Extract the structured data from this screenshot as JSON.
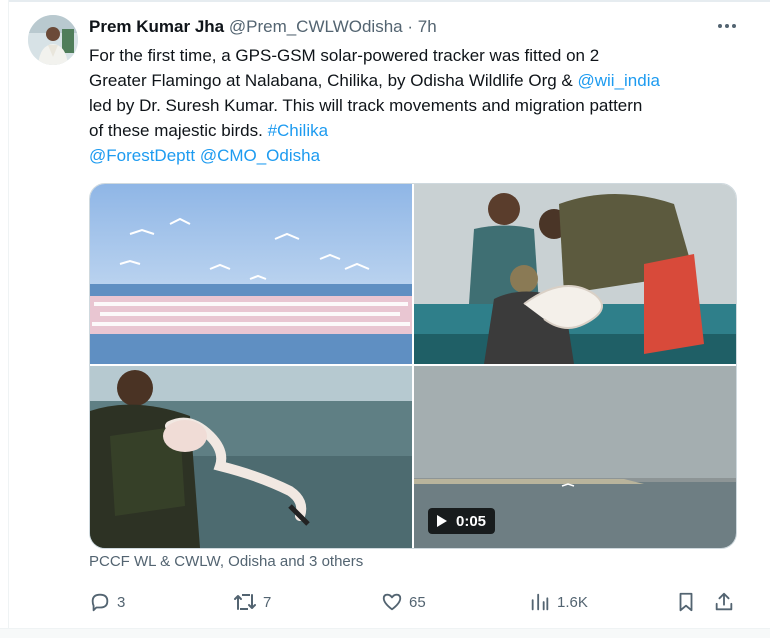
{
  "tweet": {
    "author_name": "Prem Kumar Jha",
    "handle": "@Prem_CWLWOdisha",
    "separator": "·",
    "time": "7h",
    "text": {
      "l1": "For the first time, a GPS-GSM solar-powered tracker was fitted on 2",
      "l2_a": "Greater Flamingo at Nalabana, Chilika, by Odisha Wildlife Org & ",
      "l2_link": "@wii_india",
      "l3": "led by Dr. Suresh Kumar. This will track movements and migration pattern",
      "l4_a": "of these majestic birds. ",
      "l4_link": "#Chilika",
      "l5_link1": "@ForestDeptt",
      "l5_sp": " ",
      "l5_link2": "@CMO_Odisha"
    },
    "video_duration": "0:05",
    "tagged": "PCCF WL & CWLW, Odisha and 3 others",
    "stats": {
      "replies": "3",
      "reposts": "7",
      "likes": "65",
      "views": "1.6K"
    }
  },
  "icons": {
    "more": "more-horizontal-icon",
    "reply": "reply-icon",
    "repost": "repost-icon",
    "like": "heart-icon",
    "views": "views-icon",
    "bookmark": "bookmark-icon",
    "share": "share-icon",
    "play": "play-icon"
  },
  "colors": {
    "link": "#1d9bf0",
    "text": "#0f1419",
    "muted": "#536471"
  }
}
